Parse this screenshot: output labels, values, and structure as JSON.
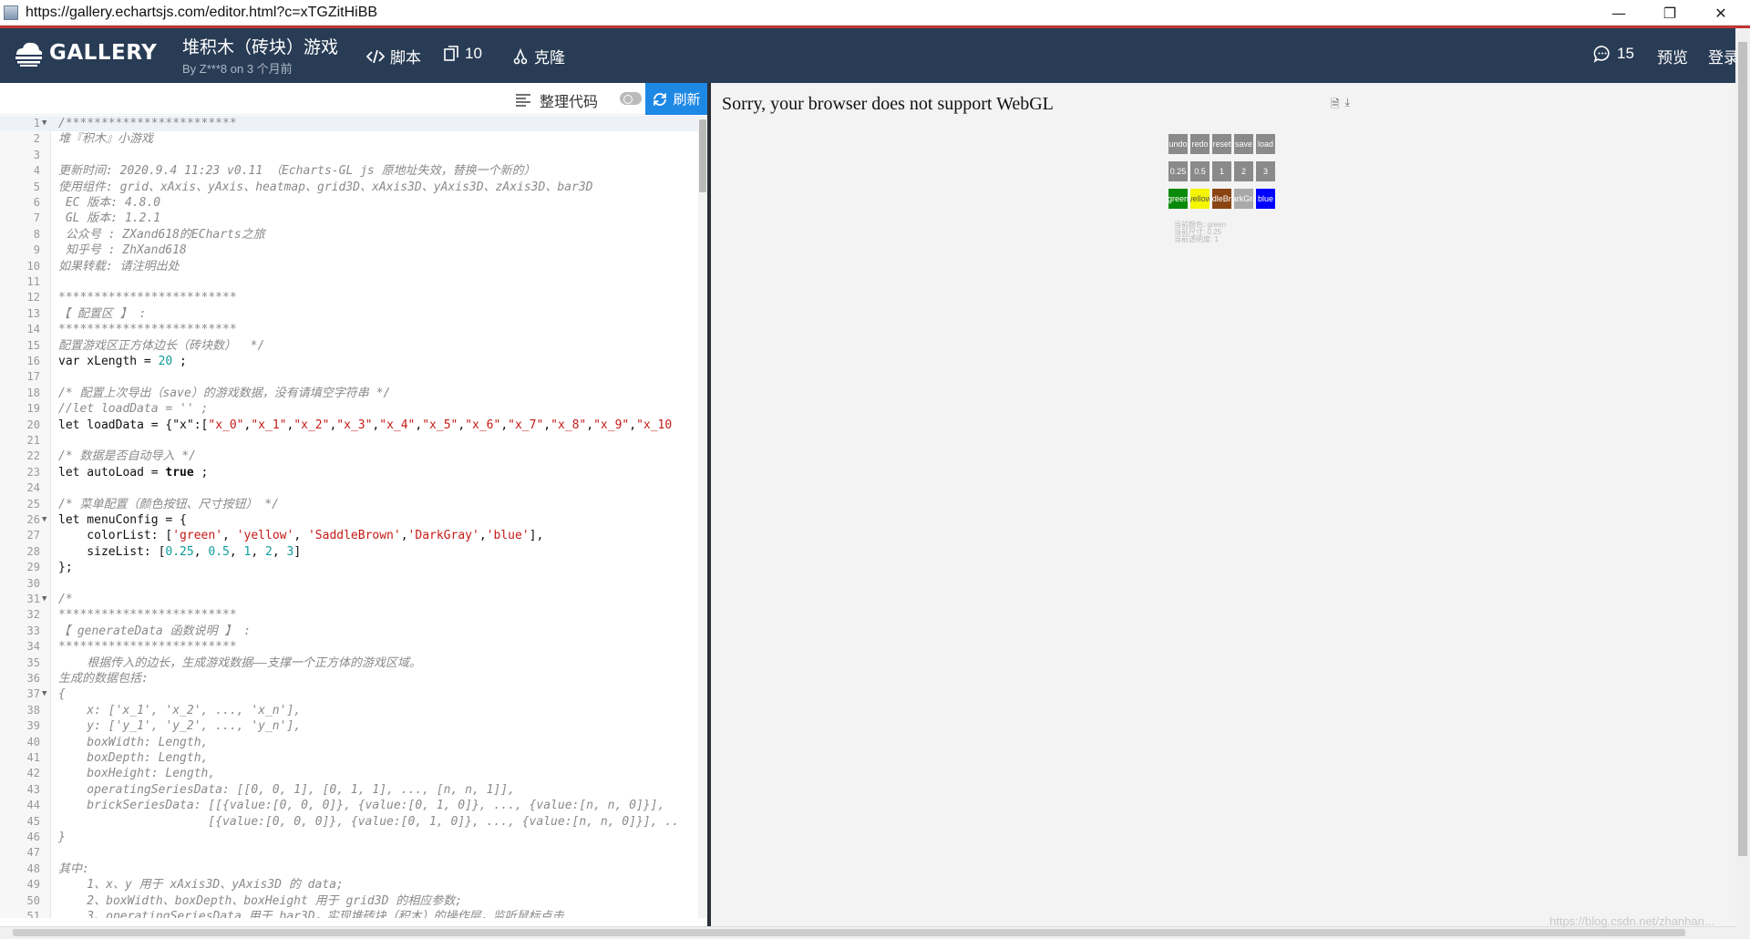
{
  "window": {
    "url": "https://gallery.echartsjs.com/editor.html?c=xTGZitHiBB",
    "minimize": "—",
    "restore": "❐",
    "close": "✕"
  },
  "header": {
    "logo_text": "GALLERY",
    "chart_title": "堆积木（砖块）游戏",
    "chart_author": "By Z***8 on 3 个月前",
    "script_label": "脚本",
    "fork_count": "10",
    "clone_label": "克隆",
    "comment_count": "15",
    "preview_label": "预览",
    "login_label": "登录"
  },
  "toolbar": {
    "format_label": "整理代码",
    "run_label": "刷新"
  },
  "code_lines": [
    [
      {
        "t": "/************************",
        "c": "comment"
      }
    ],
    [
      {
        "t": "堆『积木』小游戏",
        "c": "comment"
      }
    ],
    [],
    [
      {
        "t": "更新时间: 2020.9.4 11:23 v0.11 （Echarts-GL js 原地址失效，替换一个新的）",
        "c": "comment"
      }
    ],
    [
      {
        "t": "使用组件: grid、xAxis、yAxis、heatmap、grid3D、xAxis3D、yAxis3D、zAxis3D、bar3D",
        "c": "comment"
      }
    ],
    [
      {
        "t": " EC 版本: 4.8.0",
        "c": "comment"
      }
    ],
    [
      {
        "t": " GL 版本: 1.2.1",
        "c": "comment"
      }
    ],
    [
      {
        "t": " 公众号 : ZXand618的ECharts之旅",
        "c": "comment"
      }
    ],
    [
      {
        "t": " 知乎号 : ZhXand618",
        "c": "comment"
      }
    ],
    [
      {
        "t": "如果转载: 请注明出处",
        "c": "comment"
      }
    ],
    [],
    [
      {
        "t": "*************************",
        "c": "comment"
      }
    ],
    [
      {
        "t": "【 配置区 】 :",
        "c": "comment"
      }
    ],
    [
      {
        "t": "*************************",
        "c": "comment"
      }
    ],
    [
      {
        "t": "配置游戏区正方体边长（砖块数）  */",
        "c": "comment"
      }
    ],
    [
      {
        "t": "var xLength = ",
        "c": "kw"
      },
      {
        "t": "20",
        "c": "num"
      },
      {
        "t": " ;",
        "c": "kw"
      }
    ],
    [],
    [
      {
        "t": "/* 配置上次导出（save）的游戏数据，没有请填空字符串 */",
        "c": "comment"
      }
    ],
    [
      {
        "t": "//let loadData = '' ;",
        "c": "comment"
      }
    ],
    [
      {
        "t": "let loadData = {\"x\":[",
        "c": "kw"
      },
      {
        "t": "\"x_0\"",
        "c": "str"
      },
      {
        "t": ",",
        "c": "kw"
      },
      {
        "t": "\"x_1\"",
        "c": "str"
      },
      {
        "t": ",",
        "c": "kw"
      },
      {
        "t": "\"x_2\"",
        "c": "str"
      },
      {
        "t": ",",
        "c": "kw"
      },
      {
        "t": "\"x_3\"",
        "c": "str"
      },
      {
        "t": ",",
        "c": "kw"
      },
      {
        "t": "\"x_4\"",
        "c": "str"
      },
      {
        "t": ",",
        "c": "kw"
      },
      {
        "t": "\"x_5\"",
        "c": "str"
      },
      {
        "t": ",",
        "c": "kw"
      },
      {
        "t": "\"x_6\"",
        "c": "str"
      },
      {
        "t": ",",
        "c": "kw"
      },
      {
        "t": "\"x_7\"",
        "c": "str"
      },
      {
        "t": ",",
        "c": "kw"
      },
      {
        "t": "\"x_8\"",
        "c": "str"
      },
      {
        "t": ",",
        "c": "kw"
      },
      {
        "t": "\"x_9\"",
        "c": "str"
      },
      {
        "t": ",",
        "c": "kw"
      },
      {
        "t": "\"x_10",
        "c": "str"
      }
    ],
    [],
    [
      {
        "t": "/* 数据是否自动导入 */",
        "c": "comment"
      }
    ],
    [
      {
        "t": "let autoLoad = ",
        "c": "kw"
      },
      {
        "t": "true",
        "c": "bold"
      },
      {
        "t": " ;",
        "c": "kw"
      }
    ],
    [],
    [
      {
        "t": "/* 菜单配置（颜色按钮、尺寸按钮） */",
        "c": "comment"
      }
    ],
    [
      {
        "t": "let menuConfig = {",
        "c": "kw"
      }
    ],
    [
      {
        "t": "    colorList: [",
        "c": "kw"
      },
      {
        "t": "'green'",
        "c": "str"
      },
      {
        "t": ", ",
        "c": "kw"
      },
      {
        "t": "'yellow'",
        "c": "str"
      },
      {
        "t": ", ",
        "c": "kw"
      },
      {
        "t": "'SaddleBrown'",
        "c": "str"
      },
      {
        "t": ",",
        "c": "kw"
      },
      {
        "t": "'DarkGray'",
        "c": "str"
      },
      {
        "t": ",",
        "c": "kw"
      },
      {
        "t": "'blue'",
        "c": "str"
      },
      {
        "t": "],",
        "c": "kw"
      }
    ],
    [
      {
        "t": "    sizeList: [",
        "c": "kw"
      },
      {
        "t": "0.25",
        "c": "num"
      },
      {
        "t": ", ",
        "c": "kw"
      },
      {
        "t": "0.5",
        "c": "num"
      },
      {
        "t": ", ",
        "c": "kw"
      },
      {
        "t": "1",
        "c": "num"
      },
      {
        "t": ", ",
        "c": "kw"
      },
      {
        "t": "2",
        "c": "num"
      },
      {
        "t": ", ",
        "c": "kw"
      },
      {
        "t": "3",
        "c": "num"
      },
      {
        "t": "]",
        "c": "kw"
      }
    ],
    [
      {
        "t": "};",
        "c": "kw"
      }
    ],
    [],
    [
      {
        "t": "/*",
        "c": "comment"
      }
    ],
    [
      {
        "t": "*************************",
        "c": "comment"
      }
    ],
    [
      {
        "t": "【 generateData 函数说明 】 :",
        "c": "comment"
      }
    ],
    [
      {
        "t": "*************************",
        "c": "comment"
      }
    ],
    [
      {
        "t": "    根据传入的边长，生成游戏数据——支撑一个正方体的游戏区域。",
        "c": "comment"
      }
    ],
    [
      {
        "t": "生成的数据包括:",
        "c": "comment"
      }
    ],
    [
      {
        "t": "{",
        "c": "comment"
      }
    ],
    [
      {
        "t": "    x: ['x_1', 'x_2', ..., 'x_n'],",
        "c": "comment"
      }
    ],
    [
      {
        "t": "    y: ['y_1', 'y_2', ..., 'y_n'],",
        "c": "comment"
      }
    ],
    [
      {
        "t": "    boxWidth: Length,",
        "c": "comment"
      }
    ],
    [
      {
        "t": "    boxDepth: Length,",
        "c": "comment"
      }
    ],
    [
      {
        "t": "    boxHeight: Length,",
        "c": "comment"
      }
    ],
    [
      {
        "t": "    operatingSeriesData: [[0, 0, 1], [0, 1, 1], ..., [n, n, 1]],",
        "c": "comment"
      }
    ],
    [
      {
        "t": "    brickSeriesData: [[{value:[0, 0, 0]}, {value:[0, 1, 0]}, ..., {value:[n, n, 0]}],",
        "c": "comment"
      }
    ],
    [
      {
        "t": "                     [{value:[0, 0, 0]}, {value:[0, 1, 0]}, ..., {value:[n, n, 0]}], ..",
        "c": "comment"
      }
    ],
    [
      {
        "t": "}",
        "c": "comment"
      }
    ],
    [],
    [
      {
        "t": "其中:",
        "c": "comment"
      }
    ],
    [
      {
        "t": "    1、x、y 用于 xAxis3D、yAxis3D 的 data;",
        "c": "comment"
      }
    ],
    [
      {
        "t": "    2、boxWidth、boxDepth、boxHeight 用于 grid3D 的相应参数;",
        "c": "comment"
      }
    ],
    [
      {
        "t": "    3、operatingSeriesData 用于 bar3D，实现堆砖块（积木）的操作层，监听鼠标点击",
        "c": "comment"
      }
    ]
  ],
  "fold_lines": [
    1,
    26,
    31,
    37
  ],
  "preview": {
    "webgl_message": "Sorry, your browser does not support WebGL",
    "doc_icon": "🗎",
    "download_icon": "⤓",
    "menu_actions": [
      "undo",
      "redo",
      "reset",
      "save",
      "load"
    ],
    "menu_sizes": [
      "0.25",
      "0.5",
      "1",
      "2",
      "3"
    ],
    "menu_colors": [
      {
        "label": "green",
        "color": "#0a8a0a"
      },
      {
        "label": "yellow",
        "color": "#f5f500"
      },
      {
        "label": "SaddleBrown",
        "color": "#8b4513"
      },
      {
        "label": "DarkGray",
        "color": "#a9a9a9"
      },
      {
        "label": "blue",
        "color": "#0000ff"
      }
    ],
    "status_lines": [
      "当前颜色: green",
      "当前尺寸: 0.25",
      "当前透明度: 1"
    ]
  },
  "watermark": "https://blog.csdn.net/zhanhan..."
}
